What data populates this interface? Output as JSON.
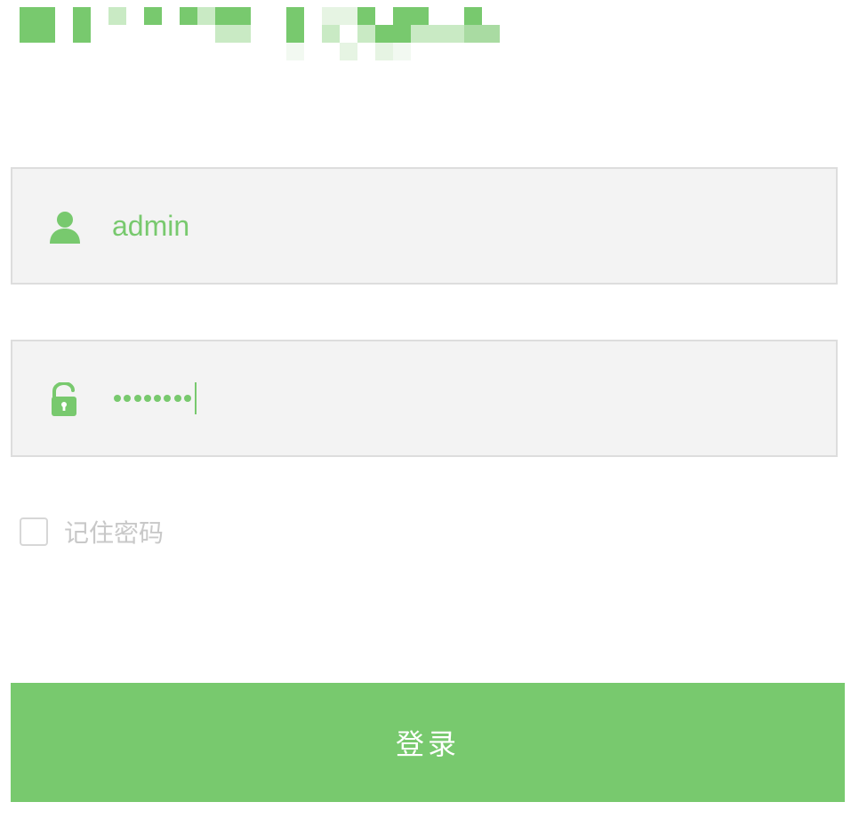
{
  "username": {
    "value": "admin",
    "icon": "user-icon"
  },
  "password": {
    "masked_value": "••••••••",
    "dot_count": 8,
    "icon": "unlock-icon"
  },
  "remember": {
    "label": "记住密码",
    "checked": false
  },
  "login_button": {
    "label": "登录"
  },
  "colors": {
    "accent": "#78c96e",
    "field_bg": "#f3f3f3",
    "field_border": "#dddddd",
    "muted_text": "#c8c8c8"
  }
}
